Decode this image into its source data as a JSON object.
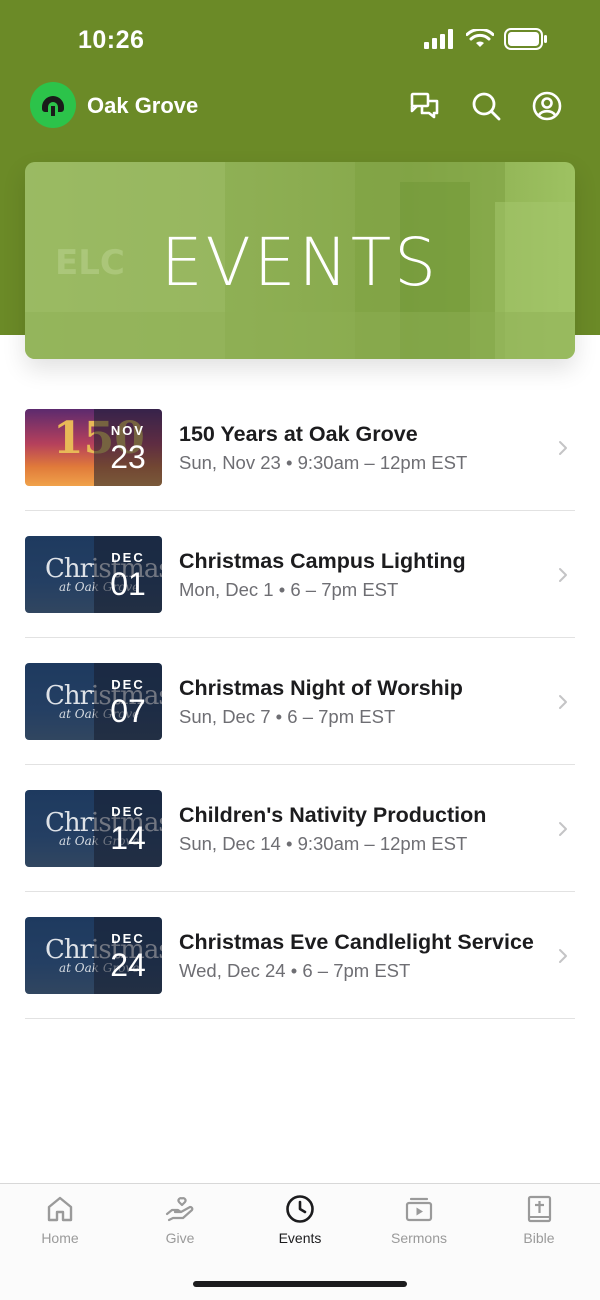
{
  "status_bar": {
    "time": "10:26"
  },
  "app": {
    "name": "Oak Grove",
    "colors": {
      "header": "#6b8a27",
      "logo": "#2cc34a"
    }
  },
  "nav_icons": [
    "chat-icon",
    "search-icon",
    "profile-icon"
  ],
  "hero": {
    "title": "EVENTS"
  },
  "events": [
    {
      "title": "150 Years at Oak Grove",
      "meta": "Sun, Nov 23 • 9:30am – 12pm EST",
      "month": "NOV",
      "day": "23",
      "art": "150"
    },
    {
      "title": "Christmas Campus Lighting",
      "meta": "Mon, Dec 1 • 6 – 7pm EST",
      "month": "DEC",
      "day": "01",
      "art": "Christmas"
    },
    {
      "title": "Christmas Night of Worship",
      "meta": "Sun, Dec 7 • 6 – 7pm EST",
      "month": "DEC",
      "day": "07",
      "art": "Christmas"
    },
    {
      "title": "Children's Nativity Production",
      "meta": "Sun, Dec 14 • 9:30am – 12pm EST",
      "month": "DEC",
      "day": "14",
      "art": "Christmas"
    },
    {
      "title": "Christmas Eve Candlelight Service",
      "meta": "Wed, Dec 24 • 6 – 7pm EST",
      "month": "DEC",
      "day": "24",
      "art": "Christmas"
    }
  ],
  "thumb_subtitle": "at Oak Grove",
  "tabs": [
    {
      "label": "Home",
      "icon": "home-icon",
      "active": false
    },
    {
      "label": "Give",
      "icon": "give-icon",
      "active": false
    },
    {
      "label": "Events",
      "icon": "clock-icon",
      "active": true
    },
    {
      "label": "Sermons",
      "icon": "play-icon",
      "active": false
    },
    {
      "label": "Bible",
      "icon": "bible-icon",
      "active": false
    }
  ]
}
